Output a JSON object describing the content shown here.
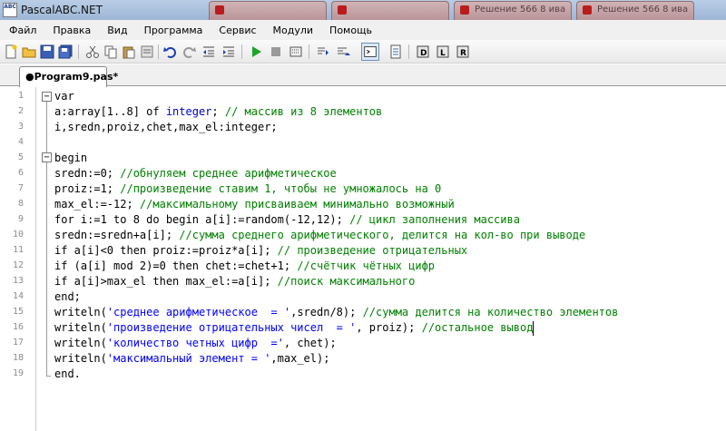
{
  "window": {
    "title": "PascalABC.NET",
    "icon_text": "ABC",
    "background_tabs": [
      "",
      "",
      "Решение 566 8 ива",
      "Решение 566 8 ива"
    ]
  },
  "menu": [
    "Файл",
    "Правка",
    "Вид",
    "Программа",
    "Сервис",
    "Модули",
    "Помощь"
  ],
  "toolbar": {
    "icons": [
      "new-file-icon",
      "open-icon",
      "save-icon",
      "save-all-icon",
      "cut-icon",
      "copy-icon",
      "paste-icon",
      "undo-icon",
      "redo-icon",
      "outdent-icon",
      "indent-icon",
      "run-icon",
      "stop-icon",
      "compile-icon",
      "step-icon",
      "step-over-icon",
      "console-icon",
      "form-icon",
      "debug-icon",
      "library-icon",
      "reference-icon"
    ]
  },
  "editor": {
    "tab_label": "●Program9.pas*",
    "line_numbers": [
      "1",
      "2",
      "3",
      "4",
      "5",
      "6",
      "7",
      "8",
      "9",
      "10",
      "11",
      "12",
      "13",
      "14",
      "15",
      "16",
      "17",
      "18",
      "19"
    ],
    "lines": [
      [
        {
          "t": "var",
          "c": "kw"
        }
      ],
      [
        {
          "t": "a:array[1..8] of ",
          "c": "kw"
        },
        {
          "t": "integer",
          "c": "tp"
        },
        {
          "t": "; ",
          "c": "kw"
        },
        {
          "t": "// массив из 8 элементов",
          "c": "cm"
        }
      ],
      [
        {
          "t": "i,sredn,proiz,chet,max_el:integer;",
          "c": "kw"
        }
      ],
      [],
      [
        {
          "t": "begin",
          "c": "kw"
        }
      ],
      [
        {
          "t": "sredn:=0; ",
          "c": "kw"
        },
        {
          "t": "//обнуляем среднее арифметическое",
          "c": "cm"
        }
      ],
      [
        {
          "t": "proiz:=1; ",
          "c": "kw"
        },
        {
          "t": "//произведение ставим 1, чтобы не умножалось на 0",
          "c": "cm"
        }
      ],
      [
        {
          "t": "max_el:=-12; ",
          "c": "kw"
        },
        {
          "t": "//максимальному присваиваем минимально возможный",
          "c": "cm"
        }
      ],
      [
        {
          "t": "for i:=1 to 8 do begin a[i]:=random(-12,12); ",
          "c": "kw"
        },
        {
          "t": "// цикл заполнения массива",
          "c": "cm"
        }
      ],
      [
        {
          "t": "sredn:=sredn+a[i]; ",
          "c": "kw"
        },
        {
          "t": "//сумма среднего арифметического, делится на кол-во при выводе",
          "c": "cm"
        }
      ],
      [
        {
          "t": "if a[i]<0 then proiz:=proiz*a[i]; ",
          "c": "kw"
        },
        {
          "t": "// произведение отрицательных",
          "c": "cm"
        }
      ],
      [
        {
          "t": "if (a[i] mod 2)=0 then chet:=chet+1; ",
          "c": "kw"
        },
        {
          "t": "//счётчик чётных цифр",
          "c": "cm"
        }
      ],
      [
        {
          "t": "if a[i]>max_el then max_el:=a[i]; ",
          "c": "kw"
        },
        {
          "t": "//поиск максимального",
          "c": "cm"
        }
      ],
      [
        {
          "t": "end;",
          "c": "kw"
        }
      ],
      [
        {
          "t": "writeln(",
          "c": "kw"
        },
        {
          "t": "'среднее арифметическое  = '",
          "c": "st"
        },
        {
          "t": ",sredn/8); ",
          "c": "kw"
        },
        {
          "t": "//сумма делится на количество элементов",
          "c": "cm"
        }
      ],
      [
        {
          "t": "writeln(",
          "c": "kw"
        },
        {
          "t": "'произведение отрицательных чисел  = '",
          "c": "st"
        },
        {
          "t": ", proiz); ",
          "c": "kw"
        },
        {
          "t": "//остальное вывод",
          "c": "cm"
        }
      ],
      [
        {
          "t": "writeln(",
          "c": "kw"
        },
        {
          "t": "'количество четных цифр  ='",
          "c": "st"
        },
        {
          "t": ", chet);",
          "c": "kw"
        }
      ],
      [
        {
          "t": "writeln(",
          "c": "kw"
        },
        {
          "t": "'максимальный элемент = '",
          "c": "st"
        },
        {
          "t": ",max_el);",
          "c": "kw"
        }
      ],
      [
        {
          "t": "end.",
          "c": "kw"
        }
      ]
    ]
  }
}
